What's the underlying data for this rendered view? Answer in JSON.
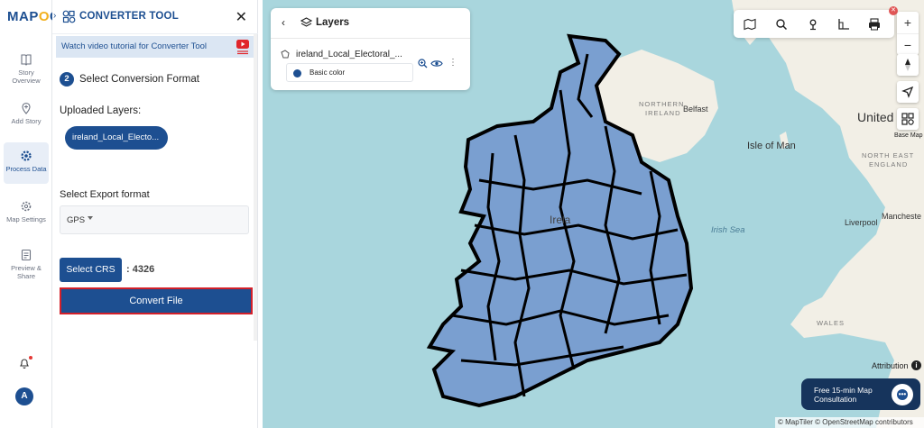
{
  "brand": {
    "logo_text": "MAPOG"
  },
  "rail": {
    "items": [
      {
        "label": "Story Overview",
        "icon": "book-icon"
      },
      {
        "label": "Add Story",
        "icon": "pin-plus-icon"
      },
      {
        "label": "Process Data",
        "icon": "gear-icon",
        "active": true
      },
      {
        "label": "Map Settings",
        "icon": "settings-icon"
      },
      {
        "label": "Preview & Share",
        "icon": "preview-icon"
      }
    ],
    "avatar_letter": "A"
  },
  "panel": {
    "title": "CONVERTER TOOL",
    "tutorial_text": "Watch video tutorial for Converter Tool",
    "step_number": "2",
    "step_title": "Select Conversion Format",
    "uploaded_label": "Uploaded Layers:",
    "uploaded_layer": "ireland_Local_Electo...",
    "export_label": "Select Export format",
    "export_value": "GPS",
    "crs_button": "Select CRS",
    "crs_value": ": 4326",
    "convert_button": "Convert File"
  },
  "layers_card": {
    "title": "Layers",
    "layer_name": "ireland_Local_Electoral_...",
    "style_label": "Basic color"
  },
  "map": {
    "labels": {
      "northern_ireland": "NORTHERN",
      "northern_ireland_2": "IRELAND",
      "belfast": "Belfast",
      "isle_of_man": "Isle of Man",
      "united": "United",
      "north_east": "NORTH EAST",
      "england": "ENGLAND",
      "irish_sea": "Irish Sea",
      "ireland": "Irela",
      "liverpool": "Liverpool",
      "manchester": "Mancheste",
      "wales": "WALES",
      "base_map": "Base Map"
    },
    "attribution": "Attribution",
    "copyright": "© MapTiler © OpenStreetMap contributors",
    "consultation": "Free 15-min Map Consultation"
  },
  "colors": {
    "brand": "#1d4f91",
    "sea": "#a9d6dd",
    "land": "#f2efe6",
    "polygon_fill": "#7a9fd0",
    "highlight": "#d3202a"
  }
}
